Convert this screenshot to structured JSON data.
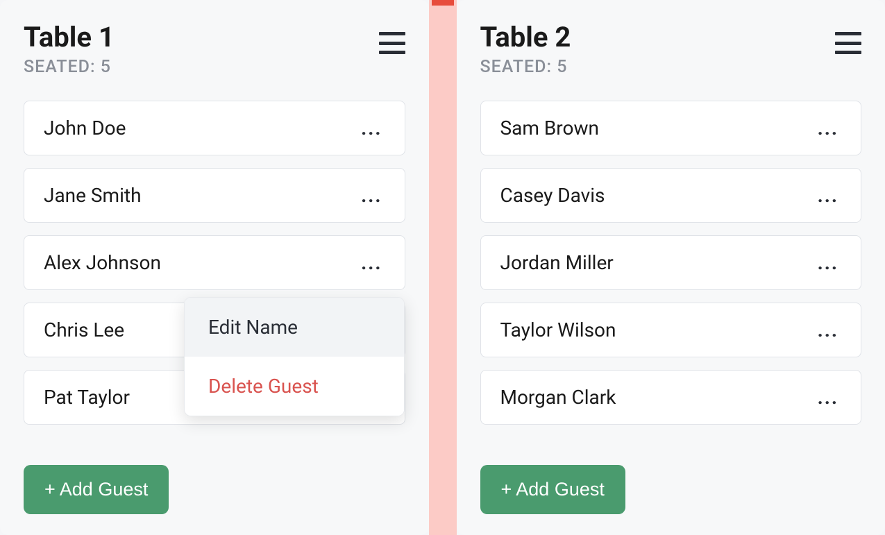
{
  "tables": [
    {
      "title": "Table 1",
      "seated_label": "SEATED: 5",
      "guests": [
        {
          "name": "John Doe"
        },
        {
          "name": "Jane Smith"
        },
        {
          "name": "Alex Johnson"
        },
        {
          "name": "Chris Lee"
        },
        {
          "name": "Pat Taylor"
        }
      ],
      "add_guest_label": "+ Add Guest"
    },
    {
      "title": "Table 2",
      "seated_label": "SEATED: 5",
      "guests": [
        {
          "name": "Sam Brown"
        },
        {
          "name": "Casey Davis"
        },
        {
          "name": "Jordan Miller"
        },
        {
          "name": "Taylor Wilson"
        },
        {
          "name": "Morgan Clark"
        }
      ],
      "add_guest_label": "+ Add Guest"
    }
  ],
  "context_menu": {
    "edit_label": "Edit Name",
    "delete_label": "Delete Guest"
  }
}
